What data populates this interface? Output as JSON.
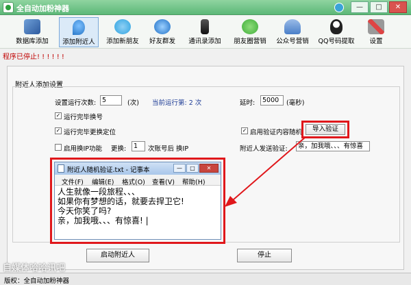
{
  "window": {
    "title": "全自动加粉神器",
    "buttons": [
      "—",
      "□",
      "✕"
    ]
  },
  "toolbar": {
    "items": [
      {
        "label": "数据库添加",
        "icon": "database-icon",
        "color": "#4a7fbf"
      },
      {
        "label": "添加附近人",
        "icon": "location-pin-icon",
        "color": "#3b8ee0",
        "active": true
      },
      {
        "label": "添加新朋友",
        "icon": "chat-bubbles-icon",
        "color": "#2fa3e0"
      },
      {
        "label": "好友群发",
        "icon": "speech-bubble-icon",
        "color": "#1f8fe6"
      },
      {
        "label": "通讯录添加",
        "icon": "phone-icon",
        "color": "#333333"
      },
      {
        "label": "朋友圈营销",
        "icon": "wechat-icon",
        "color": "#3fae3a"
      },
      {
        "label": "公众号营销",
        "icon": "people-icon",
        "color": "#5b8fd8"
      },
      {
        "label": "QQ号码提取",
        "icon": "qq-penguin-icon",
        "color": "#222222"
      },
      {
        "label": "设置",
        "icon": "tools-icon",
        "color": "#7a7a7a"
      }
    ]
  },
  "status_message": "程序已停止! ! ! ! ! !",
  "section_title": "附近人添加设置",
  "settings": {
    "run_times_label": "设置运行次数:",
    "run_times_value": "5",
    "run_times_unit": "(次)",
    "current_run_label": "当前运行第: 2 次",
    "delay_label": "延时:",
    "delay_value": "5000",
    "delay_unit": "(毫秒)",
    "chk_switch_number": "运行完毕换号",
    "chk_switch_location": "运行完毕更换定位",
    "chk_random_verify": "启用验证内容随机",
    "import_button": "导入验证",
    "chk_ip": "启用换IP功能",
    "change_label": "更换:",
    "change_value": "1",
    "change_suffix": "次账号后 换IP",
    "send_verify_label": "附近人发送验证:",
    "send_verify_value": "亲，加我哦、、、有惊喜"
  },
  "notepad": {
    "title": "附近人随机验证.txt - 记事本",
    "menu": [
      "文件(F)",
      "编辑(E)",
      "格式(O)",
      "查看(V)",
      "帮助(H)"
    ],
    "text": "人生就像一段旅程、、、\n如果你有梦想的话，就要去捍卫它!\n今天你笑了吗?\n亲，加我哦、、、有惊喜! |"
  },
  "buttons": {
    "start": "启动附近人",
    "stop": "停止"
  },
  "watermark": "自媒体哈哈讯吧",
  "statusbar": "版权：全自动加粉神器",
  "colors": {
    "title_bar": "#5cb878",
    "highlight_red": "#e0171b",
    "status_red": "#c00000",
    "run_count_blue": "#1e3c96"
  }
}
